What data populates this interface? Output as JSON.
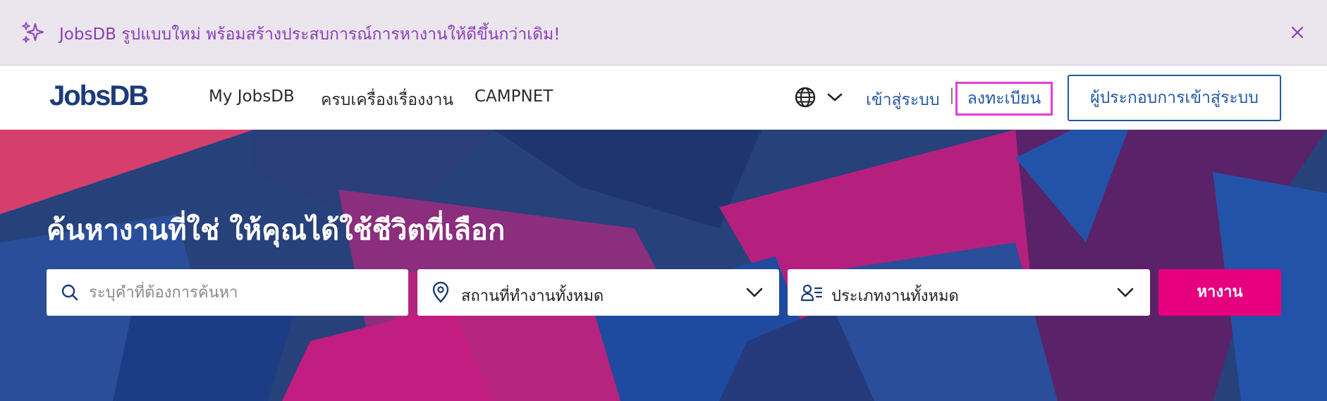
{
  "announcement": {
    "message": "JobsDB รูปแบบใหม่ พร้อมสร้างประสบการณ์การหางานให้ดีขึ้นกว่าเดิม!",
    "icon": "sparkle-icon",
    "close_icon": "close-icon"
  },
  "header": {
    "logo": "JobsDB",
    "nav": [
      {
        "label": "My JobsDB"
      },
      {
        "label": "ครบเครื่องเรื่องงาน"
      },
      {
        "label": "CAMPNET"
      }
    ],
    "language_icon": "globe-icon",
    "sign_in": "เข้าสู่ระบบ",
    "separator": "|",
    "register": "ลงทะเบียน",
    "employer_sign_in": "ผู้ประกอบการเข้าสู่ระบบ"
  },
  "hero": {
    "title": "ค้นหางานที่ใช่ ให้คุณได้ใช้ชีวิตที่เลือก",
    "search": {
      "placeholder": "ระบุคำที่ต้องการค้นหา",
      "value": ""
    },
    "location": {
      "selected": "สถานที่ทำงานทั้งหมด"
    },
    "job_type": {
      "selected": "ประเภทงานทั้งหมด"
    },
    "search_button": "หางาน"
  },
  "colors": {
    "brand_navy": "#1c3b78",
    "link_blue": "#2257a5",
    "accent_pink": "#e6007e",
    "announce_bg": "#ebe5ee",
    "announce_text": "#8a3fb5",
    "highlight": "#e040d8"
  }
}
